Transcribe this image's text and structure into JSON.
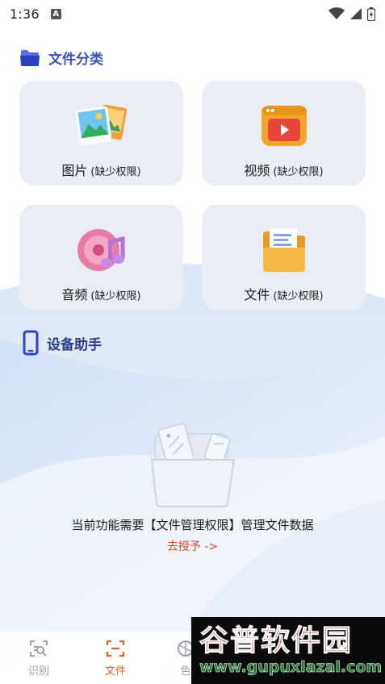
{
  "status_bar": {
    "time": "1:36",
    "notification_icon_letter": "A",
    "icons": [
      "wifi-icon",
      "signal-icon",
      "battery-icon"
    ]
  },
  "file_categories": {
    "title": "文件分类",
    "icon": "folder-icon",
    "cards": [
      {
        "name": "图片",
        "status": "(缺少权限)",
        "icon": "image-icon"
      },
      {
        "name": "视频",
        "status": "(缺少权限)",
        "icon": "video-icon"
      },
      {
        "name": "音频",
        "status": "(缺少权限)",
        "icon": "audio-icon"
      },
      {
        "name": "文件",
        "status": "(缺少权限)",
        "icon": "document-folder-icon"
      }
    ]
  },
  "device_assistant": {
    "title": "设备助手",
    "icon": "phone-icon",
    "empty_message": "当前功能需要【文件管理权限】管理文件数据",
    "grant_link": "去授予 ->"
  },
  "bottom_nav": {
    "items": [
      {
        "label": "识别",
        "icon": "scan-icon",
        "active": false
      },
      {
        "label": "文件",
        "icon": "file-scan-icon",
        "active": true
      },
      {
        "label": "色",
        "icon": "color-icon",
        "active": false
      }
    ]
  },
  "watermark": {
    "title": "谷普软件园",
    "url": "www.gupuxlazal.com"
  },
  "colors": {
    "accent_blue": "#3a4fc7",
    "card_bg": "#e9eef6",
    "active_tab": "#e0652b",
    "link_red": "#e0452b"
  }
}
